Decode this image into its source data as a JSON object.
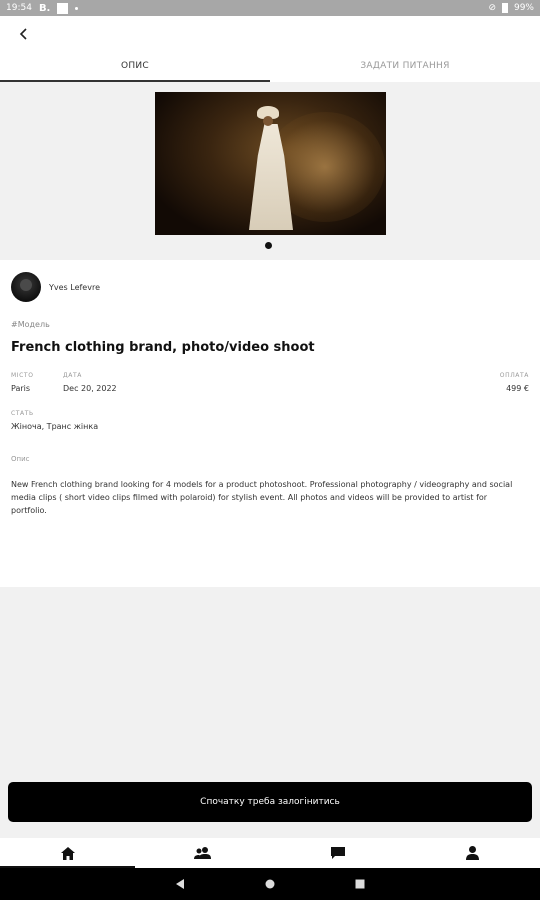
{
  "status_bar": {
    "time": "19:54",
    "app_letter": "B.",
    "battery": "99%"
  },
  "header": {
    "back_label": "‹"
  },
  "tabs": [
    {
      "label": "ОПИС",
      "active": true
    },
    {
      "label": "ЗАДАТИ ПИТАННЯ",
      "active": false
    }
  ],
  "author": {
    "name": "Yves Lefevre"
  },
  "job": {
    "category": "#Модель",
    "title": "French clothing brand, photo/video shoot",
    "place_label": "МІСТО",
    "place": "Paris",
    "date_label": "ДАТА",
    "date": "Dec 20, 2022",
    "pay_label": "ОПЛАТА",
    "pay": "499 €",
    "gender_label": "СТАТЬ",
    "gender": "Жіноча, Транс жінка",
    "description_label": "Опис",
    "description": "New French clothing brand looking for 4 models for a product photoshoot. Professional photography / videography and social media clips ( short video clips filmed with polaroid) for stylish event. All photos and videos will be provided to artist for portfolio."
  },
  "login_button": "Спочатку треба залогінитись",
  "bottom_nav": [
    "home-icon",
    "people-icon",
    "chat-icon",
    "profile-icon"
  ]
}
